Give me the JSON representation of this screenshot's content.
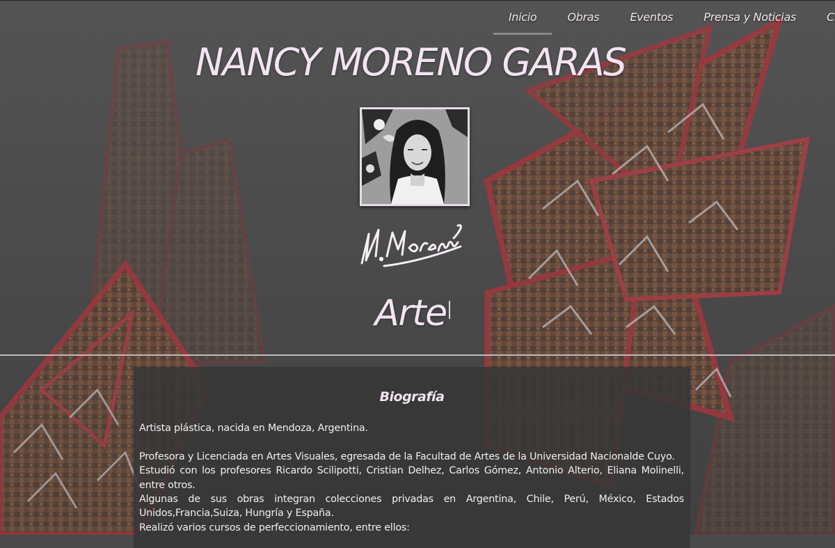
{
  "nav": {
    "items": [
      {
        "label": "Inicio",
        "active": true
      },
      {
        "label": "Obras",
        "active": false
      },
      {
        "label": "Eventos",
        "active": false
      },
      {
        "label": "Prensa y Noticias",
        "active": false
      },
      {
        "label": "C",
        "active": false
      }
    ]
  },
  "header": {
    "title": "NANCY MORENO GARAS",
    "signature": "N.Moreno",
    "tagline": "Arte"
  },
  "biography": {
    "title": "Biografía",
    "paragraphs": [
      "Artista plástica, nacida en Mendoza, Argentina.",
      "",
      "Profesora y Licenciada en Artes Visuales, egresada de la Facultad de Artes de la Universidad Nacionalde Cuyo.",
      "Estudió con los profesores Ricardo Scilipotti, Cristian Delhez, Carlos Gómez, Antonio Alterio, Eliana Molinelli, entre otros.",
      "Algunas de sus obras integran colecciones privadas en Argentina, Chile, Perú, México, Estados Unidos,Francia,Suiza, Hungría y España.",
      "Realizó varios cursos de perfeccionamiento, entre ellos:"
    ]
  },
  "colors": {
    "background": "#4a4a4a",
    "title_text": "#f3e4f2",
    "panel": "#373737",
    "artwork_red": "#9a2a2e"
  }
}
